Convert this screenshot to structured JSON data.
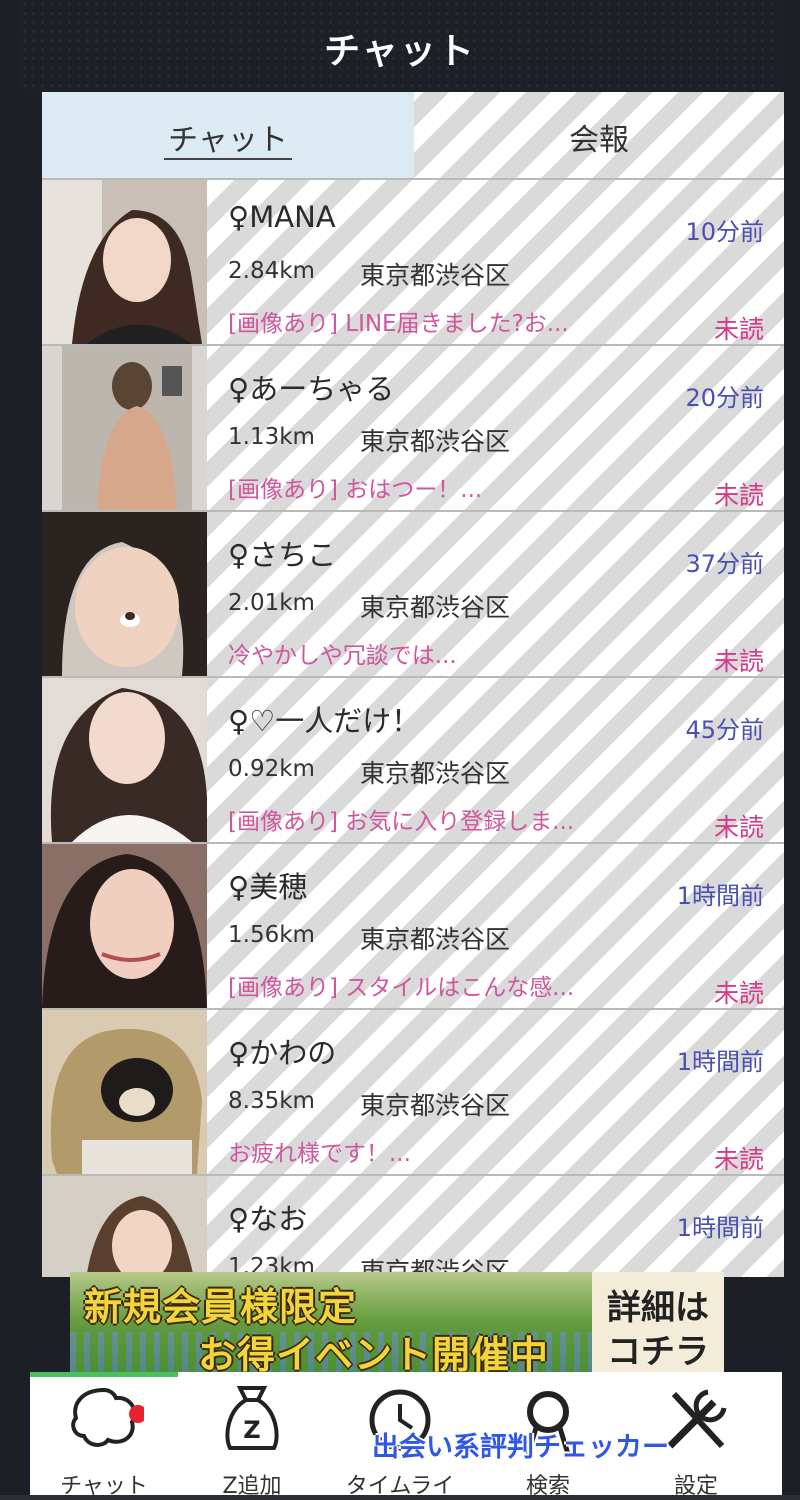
{
  "header": {
    "title": "チャット"
  },
  "tabs": [
    {
      "label": "チャット"
    },
    {
      "label": "会報"
    }
  ],
  "chats": [
    {
      "name": "♀MANA",
      "time": "10分前",
      "distance": "2.84km",
      "area": "東京都渋谷区",
      "message": "[画像あり] LINE届きました?お...",
      "status": "未読"
    },
    {
      "name": "♀あーちゃる",
      "time": "20分前",
      "distance": "1.13km",
      "area": "東京都渋谷区",
      "message": "[画像あり] おはつー！...",
      "status": "未読"
    },
    {
      "name": "♀さちこ",
      "time": "37分前",
      "distance": "2.01km",
      "area": "東京都渋谷区",
      "message": "冷やかしや冗談では...",
      "status": "未読"
    },
    {
      "name": "♀♡一人だけ！",
      "time": "45分前",
      "distance": "0.92km",
      "area": "東京都渋谷区",
      "message": "[画像あり] お気に入り登録しま...",
      "status": "未読"
    },
    {
      "name": "♀美穂",
      "time": "1時間前",
      "distance": "1.56km",
      "area": "東京都渋谷区",
      "message": "[画像あり] スタイルはこんな感...",
      "status": "未読"
    },
    {
      "name": "♀かわの",
      "time": "1時間前",
      "distance": "8.35km",
      "area": "東京都渋谷区",
      "message": "お疲れ様です！...",
      "status": "未読"
    },
    {
      "name": "♀なお",
      "time": "1時間前",
      "distance": "1.23km",
      "area": "東京都渋谷区",
      "message": "",
      "status": ""
    }
  ],
  "banner": {
    "line1": "新規会員様限定",
    "line2": "お得イベント開催中",
    "cta1": "詳細は",
    "cta2": "コチラ"
  },
  "nav": [
    {
      "label": "チャット",
      "icon": "chat-bubble-icon"
    },
    {
      "label": "Z追加",
      "icon": "money-bag-icon"
    },
    {
      "label": "タイムライ",
      "icon": "clock-icon"
    },
    {
      "label": "検索",
      "icon": "search-icon"
    },
    {
      "label": "設定",
      "icon": "settings-tools-icon"
    }
  ],
  "watermark": "出会い系評判チェッカー",
  "colors": {
    "accent_time": "#4b4fb0",
    "unread": "#d63a8b",
    "message": "#d0569e",
    "tab_active": "#dcebf3",
    "nav_progress": "#47c15a",
    "notification_dot": "#e8232d"
  }
}
